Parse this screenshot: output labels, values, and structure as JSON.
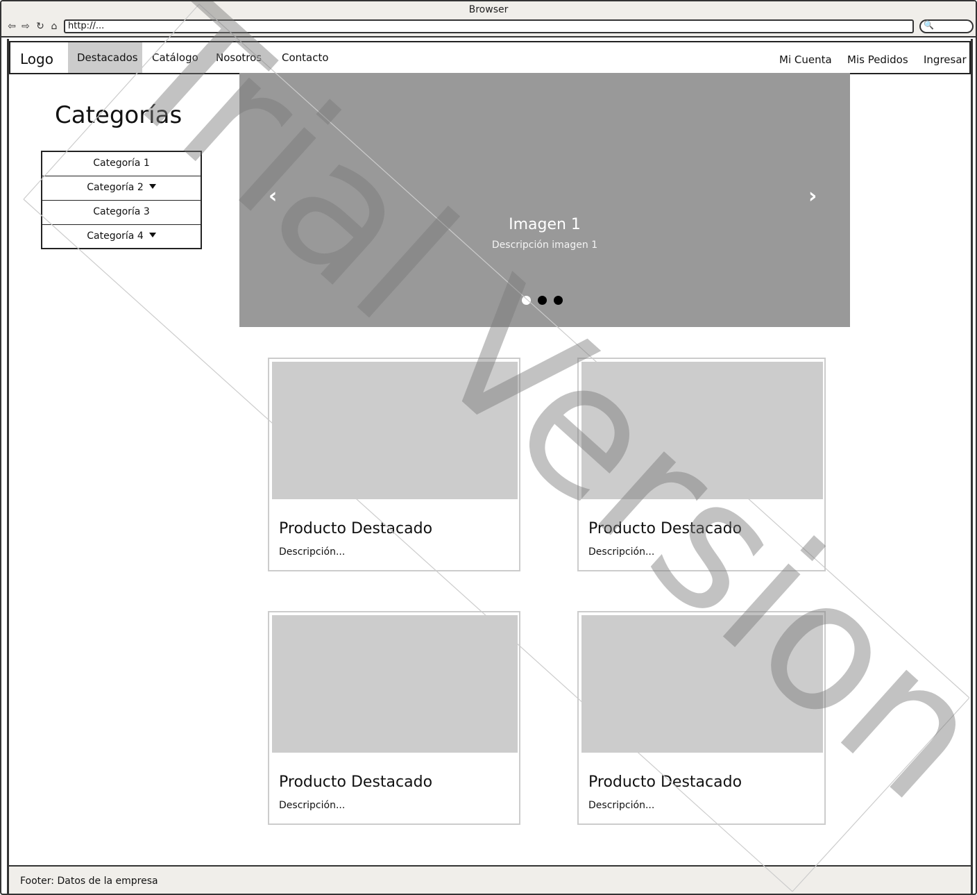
{
  "browser": {
    "title": "Browser",
    "url": "http://..."
  },
  "nav": {
    "logo": "Logo",
    "items": [
      "Destacados",
      "Catálogo",
      "Nosotros",
      "Contacto"
    ],
    "right": [
      "Mi Cuenta",
      "Mis Pedidos",
      "Ingresar"
    ]
  },
  "categories": {
    "title": "Categorías",
    "items": [
      "Categoría 1",
      "Categoría 2",
      "Categoría 3",
      "Categoría 4"
    ]
  },
  "carousel": {
    "title": "Imagen 1",
    "description": "Descripción imagen 1"
  },
  "products": [
    {
      "title": "Producto Destacado",
      "description": "Descripción..."
    },
    {
      "title": "Producto Destacado",
      "description": "Descripción..."
    },
    {
      "title": "Producto Destacado",
      "description": "Descripción..."
    },
    {
      "title": "Producto Destacado",
      "description": "Descripción..."
    }
  ],
  "footer": "Footer: Datos de la empresa",
  "watermark": "Trial Version"
}
